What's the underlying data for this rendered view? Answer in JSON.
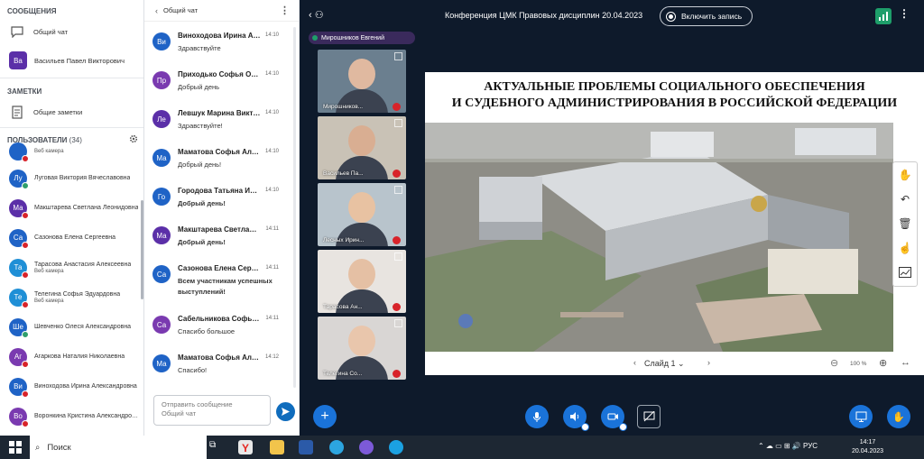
{
  "sidebar": {
    "messages_title": "СООБЩЕНИЯ",
    "general_chat": "Общий чат",
    "direct_user": {
      "initials": "Ва",
      "name": "Васильев Павел Викторович",
      "color": "#5b2fa8"
    },
    "notes_title": "ЗАМЕТКИ",
    "shared_notes": "Общие заметки",
    "users_title": "ПОЛЬЗОВАТЕЛИ",
    "users_count": "(34)",
    "users": [
      {
        "initials": "",
        "name": "",
        "sub": "Веб камера",
        "color": "#1f63c6",
        "status": "muted"
      },
      {
        "initials": "Лу",
        "name": "Луговая Виктория Вячеславовна",
        "sub": "",
        "color": "#1f63c6",
        "status": "cam"
      },
      {
        "initials": "Ма",
        "name": "Макштарева Светлана Леонидовна",
        "sub": "",
        "color": "#5b2fa8",
        "status": "muted"
      },
      {
        "initials": "Са",
        "name": "Сазонова Елена Сергеевна",
        "sub": "",
        "color": "#1f63c6",
        "status": "muted"
      },
      {
        "initials": "Та",
        "name": "Тарасова Анастасия Алексеевна",
        "sub": "Веб камера",
        "color": "#1f8fd6",
        "status": "muted"
      },
      {
        "initials": "Те",
        "name": "Телегина Софья Эдуардовна",
        "sub": "Веб камера",
        "color": "#1f8fd6",
        "status": "muted"
      },
      {
        "initials": "Ше",
        "name": "Шевченко Олеся Александровна",
        "sub": "",
        "color": "#1f63c6",
        "status": "cam"
      },
      {
        "initials": "Аг",
        "name": "Агаркова Наталия Николаевна",
        "sub": "",
        "color": "#7a3ab0",
        "status": "muted"
      },
      {
        "initials": "Ви",
        "name": "Виноходова Ирина Александровна",
        "sub": "",
        "color": "#1f63c6",
        "status": "muted"
      },
      {
        "initials": "Во",
        "name": "Воронкина Кристина Александровна",
        "sub": "",
        "color": "#7a3ab0",
        "status": "muted"
      }
    ]
  },
  "chat": {
    "title": "Общий чат",
    "messages": [
      {
        "initials": "Ви",
        "name": "Виноходова Ирина Александровна",
        "time": "14:10",
        "text": "Здравствуйте",
        "color": "#1f63c6",
        "bold": false
      },
      {
        "initials": "Пр",
        "name": "Приходько Софья Олеговна",
        "time": "14:10",
        "text": "Добрый день",
        "color": "#7a3ab0",
        "bold": false
      },
      {
        "initials": "Ле",
        "name": "Левшук Марина Викторовна",
        "time": "14:10",
        "text": "Здравствуйте!",
        "color": "#5b2fa8",
        "bold": false
      },
      {
        "initials": "Ма",
        "name": "Маматова Софья Алексеевна",
        "time": "14:10",
        "text": "Добрый день!",
        "color": "#1f63c6",
        "bold": false
      },
      {
        "initials": "Го",
        "name": "Городова Татьяна Ивановна",
        "time": "14:10",
        "text": "Добрый день!",
        "color": "#1f63c6",
        "bold": true
      },
      {
        "initials": "Ма",
        "name": "Макштарева Светлана Леонидовна",
        "time": "14:11",
        "text": "Добрый день!",
        "color": "#5b2fa8",
        "bold": true
      },
      {
        "initials": "Са",
        "name": "Сазонова Елена Сергеевна",
        "time": "14:11",
        "text": "Всем участникам успешных выступлений!",
        "color": "#1f63c6",
        "bold": true
      },
      {
        "initials": "Са",
        "name": "Сабельникова Софья Игоревна",
        "time": "14:11",
        "text": "Спасибо большое",
        "color": "#7a3ab0",
        "bold": false
      },
      {
        "initials": "Ма",
        "name": "Маматова Софья Алексеевна",
        "time": "14:12",
        "text": "Спасибо!",
        "color": "#1f63c6",
        "bold": false
      }
    ],
    "input_placeholder_line1": "Отправить сообщение",
    "input_placeholder_line2": "Общий чат"
  },
  "main": {
    "conference_title": "Конференция ЦМК Правовых дисциплин 20.04.2023",
    "record_label": "Включить запись",
    "speaker": "Мирошников Евгений",
    "videos": [
      {
        "label": "Мирошников...",
        "bg": "#6b7f8f",
        "face": "#e0b9a0"
      },
      {
        "label": "Васильев Па...",
        "bg": "#c9c2b6",
        "face": "#d9ae92"
      },
      {
        "label": "Лесных Ирин...",
        "bg": "#b8c4cc",
        "face": "#e8c2a2"
      },
      {
        "label": "Тарасова Ан...",
        "bg": "#e8e4e0",
        "face": "#e5c0a4"
      },
      {
        "label": "Телегина Со...",
        "bg": "#d9d6d4",
        "face": "#e9c6ac"
      }
    ],
    "slide": {
      "title_line1": "АКТУАЛЬНЫЕ ПРОБЛЕМЫ СОЦИАЛЬНОГО ОБЕСПЕЧЕНИЯ",
      "title_line2": "И СУДЕБНОГО АДМИНИСТРИРОВАНИЯ В РОССИЙСКОЙ ФЕДЕРАЦИИ",
      "slide_label": "Слайд 1",
      "zoom": "100 %"
    }
  },
  "taskbar": {
    "search_label": "Поиск",
    "lang": "РУС",
    "time": "14:17",
    "date": "20.04.2023"
  }
}
